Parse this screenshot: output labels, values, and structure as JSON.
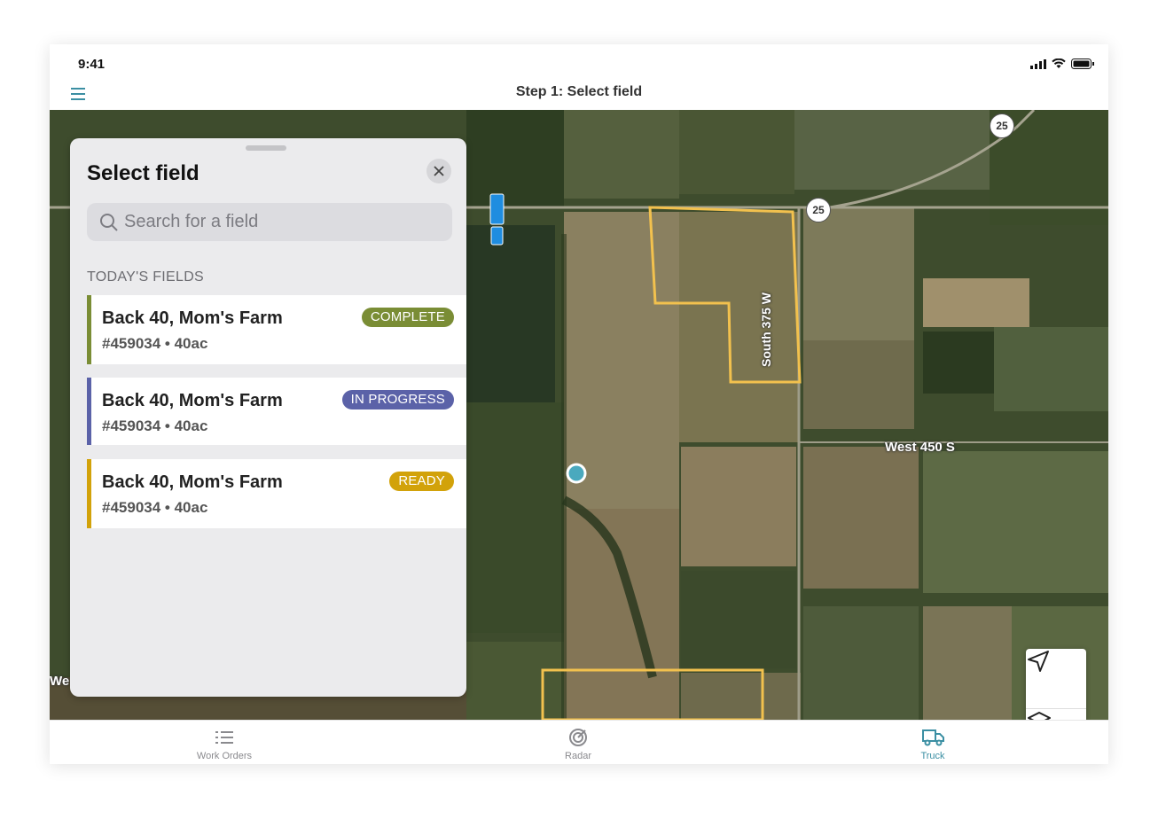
{
  "status_bar": {
    "time": "9:41"
  },
  "nav": {
    "title": "Step 1: Select field"
  },
  "map": {
    "road_labels": {
      "south": "South 375 W",
      "west_450": "West 450 S",
      "west_edge": "We"
    },
    "shields": [
      "25",
      "25"
    ]
  },
  "panel": {
    "title": "Select field",
    "search_placeholder": "Search for a field",
    "section_label": "TODAY'S FIELDS",
    "fields": [
      {
        "name": "Back 40, Mom's Farm",
        "meta": "#459034 • 40ac",
        "status": "COMPLETE",
        "color": "#7a8d35"
      },
      {
        "name": "Back 40, Mom's Farm",
        "meta": "#459034 • 40ac",
        "status": "IN PROGRESS",
        "color": "#5b62a8"
      },
      {
        "name": "Back 40, Mom's Farm",
        "meta": "#459034 • 40ac",
        "status": "READY",
        "color": "#d2a20a"
      }
    ]
  },
  "tabs": [
    {
      "label": "Work Orders",
      "icon": "list-icon",
      "active": false
    },
    {
      "label": "Radar",
      "icon": "radar-icon",
      "active": false
    },
    {
      "label": "Truck",
      "icon": "truck-icon",
      "active": true
    }
  ],
  "colors": {
    "accent": "#3b8fa3",
    "field_outline": "#f2c14e",
    "menu_icon": "#3b8fa3"
  }
}
